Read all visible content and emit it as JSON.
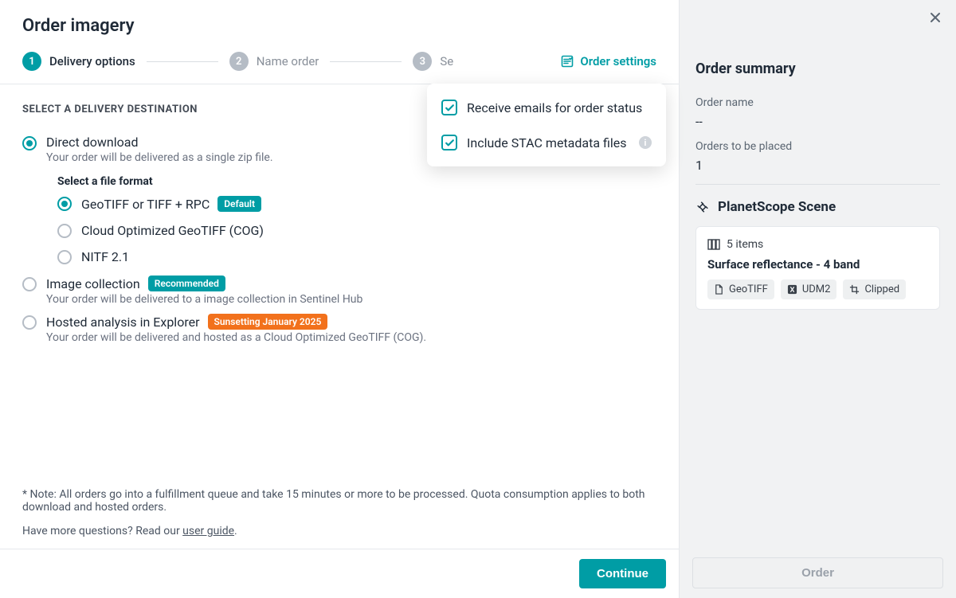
{
  "header": {
    "title": "Order imagery"
  },
  "steps": {
    "s1": {
      "num": "1",
      "label": "Delivery options"
    },
    "s2": {
      "num": "2",
      "label": "Name order"
    },
    "s3": {
      "num": "3",
      "label": "Se"
    }
  },
  "settings_btn": "Order settings",
  "popover": {
    "opt1": "Receive emails for order status",
    "opt2": "Include STAC metadata files"
  },
  "section_label": "Select a delivery destination",
  "destinations": {
    "direct": {
      "title": "Direct download",
      "desc": "Your order will be delivered as a single zip file."
    },
    "file_fmt_label": "Select a file format",
    "fmt1": {
      "label": "GeoTIFF or TIFF + RPC",
      "badge": "Default"
    },
    "fmt2": {
      "label": "Cloud Optimized GeoTIFF (COG)"
    },
    "fmt3": {
      "label": "NITF 2.1"
    },
    "collection": {
      "title": "Image collection",
      "badge": "Recommended",
      "desc": "Your order will be delivered to a image collection in Sentinel Hub"
    },
    "hosted": {
      "title": "Hosted analysis in Explorer",
      "badge": "Sunsetting January 2025",
      "desc": "Your order will be delivered and hosted as a Cloud Optimized GeoTIFF (COG)."
    }
  },
  "note": "* Note: All orders go into a fulfillment queue and take 15 minutes or more to be processed. Quota consumption applies to both download and hosted orders.",
  "questions_pre": "Have more questions? Read our ",
  "questions_link": "user guide",
  "continue_btn": "Continue",
  "summary": {
    "title": "Order summary",
    "name_label": "Order name",
    "name_val": "--",
    "count_label": "Orders to be placed",
    "count_val": "1",
    "scene_title": "PlanetScope Scene",
    "card": {
      "items": "5 items",
      "title": "Surface reflectance - 4 band",
      "chip1": "GeoTIFF",
      "chip2": "UDM2",
      "chip3": "Clipped"
    }
  },
  "order_btn": "Order"
}
